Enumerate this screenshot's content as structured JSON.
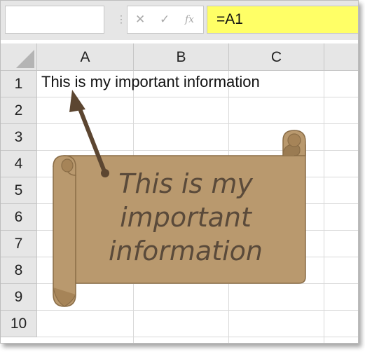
{
  "formula_bar": {
    "name_box_value": "",
    "cancel_icon": "x-icon",
    "enter_icon": "check-icon",
    "fx_label": "fx",
    "formula_value": "=A1",
    "separator": "⋮"
  },
  "grid": {
    "columns": [
      "A",
      "B",
      "C"
    ],
    "rows": [
      "1",
      "2",
      "3",
      "4",
      "5",
      "6",
      "7",
      "8",
      "9",
      "10"
    ],
    "cells": {
      "A1": "This is my important information"
    }
  },
  "callout": {
    "text_line1": "This is my",
    "text_line2": "important",
    "text_line3": "information"
  },
  "colors": {
    "formula_highlight": "#ffff66",
    "scroll_fill": "#b9996e",
    "arrow": "#5c4631",
    "header_bg": "#e6e6e6"
  }
}
